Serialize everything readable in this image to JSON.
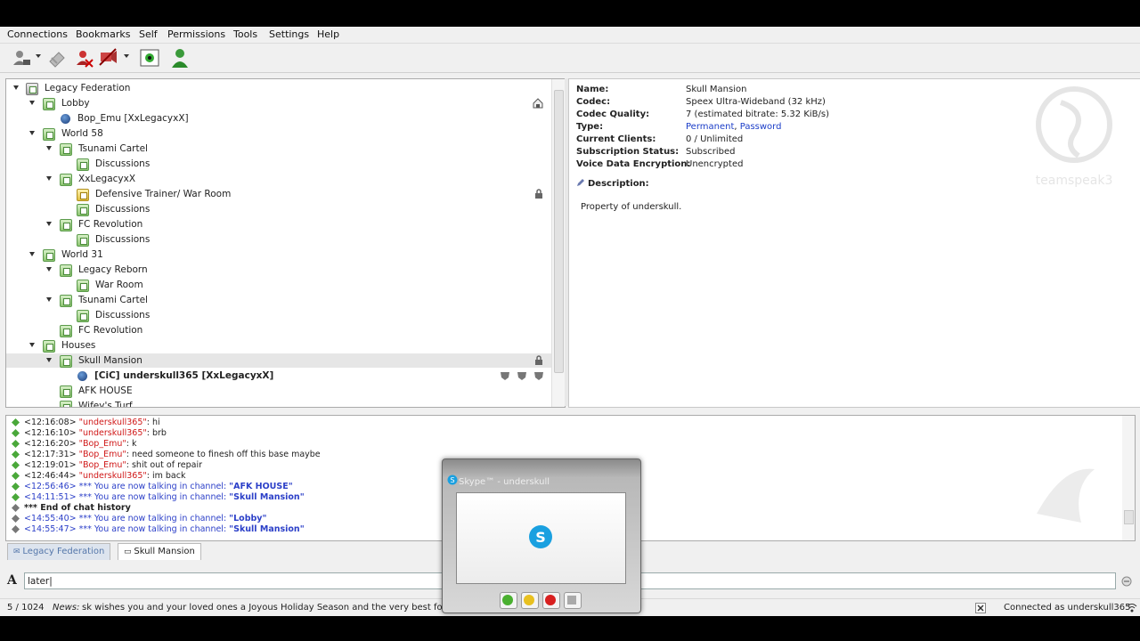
{
  "menu": [
    "Connections",
    "Bookmarks",
    "Self",
    "Permissions",
    "Tools",
    "Settings",
    "Help"
  ],
  "toolbar": {
    "icons": [
      "connect-icon",
      "disconnect-icon",
      "away-icon",
      "mute-microphone-icon",
      "server-view-icon",
      "user-icon"
    ]
  },
  "tree": [
    {
      "label": "Legacy Federation",
      "kind": "server"
    },
    {
      "label": "Lobby",
      "kind": "channel"
    },
    {
      "label": "Bop_Emu [XxLegacyxX]",
      "kind": "user"
    },
    {
      "label": "World 58",
      "kind": "channel"
    },
    {
      "label": "Tsunami Cartel",
      "kind": "channel"
    },
    {
      "label": "Discussions",
      "kind": "channel"
    },
    {
      "label": "XxLegacyxX",
      "kind": "channel"
    },
    {
      "label": "Defensive Trainer/ War Room",
      "kind": "channel"
    },
    {
      "label": "Discussions",
      "kind": "channel"
    },
    {
      "label": "FC Revolution",
      "kind": "channel"
    },
    {
      "label": "Discussions",
      "kind": "channel"
    },
    {
      "label": "World 31",
      "kind": "channel"
    },
    {
      "label": "Legacy Reborn",
      "kind": "channel"
    },
    {
      "label": "War Room",
      "kind": "channel"
    },
    {
      "label": "Tsunami Cartel",
      "kind": "channel"
    },
    {
      "label": "Discussions",
      "kind": "channel"
    },
    {
      "label": "FC Revolution",
      "kind": "channel"
    },
    {
      "label": "Houses",
      "kind": "channel"
    },
    {
      "label": "Skull Mansion",
      "kind": "channel"
    },
    {
      "label": "[CiC] underskull365 [XxLegacyxX]",
      "kind": "user"
    },
    {
      "label": "AFK HOUSE",
      "kind": "channel"
    },
    {
      "label": "Wifey's Turf",
      "kind": "channel"
    }
  ],
  "info": {
    "name_key": "Name:",
    "name": "Skull Mansion",
    "codec_key": "Codec:",
    "codec": "Speex Ultra-Wideband (32 kHz)",
    "quality_key": "Codec Quality:",
    "quality": "7 (estimated bitrate: 5.32 KiB/s)",
    "type_key": "Type:",
    "type_a": "Permanent",
    "type_sep": ", ",
    "type_b": "Password",
    "clients_key": "Current Clients:",
    "clients": "0 / Unlimited",
    "sub_key": "Subscription Status:",
    "sub": "Subscribed",
    "enc_key": "Voice Data Encryption:",
    "enc": "Unencrypted",
    "desc_key": "Description:",
    "desc": "Property of underskull.",
    "logo_text": "teamspeak3"
  },
  "chat": [
    {
      "time": "<12:16:08> ",
      "name": "\"underskull365\"",
      "msg": ": hi",
      "style": "user"
    },
    {
      "time": "<12:16:10> ",
      "name": "\"underskull365\"",
      "msg": ": brb",
      "style": "user"
    },
    {
      "time": "<12:16:20> ",
      "name": "\"Bop_Emu\"",
      "msg": ": k",
      "style": "user"
    },
    {
      "time": "<12:17:31> ",
      "name": "\"Bop_Emu\"",
      "msg": ": need someone to finesh off this base maybe",
      "style": "user"
    },
    {
      "time": "<12:19:01> ",
      "name": "\"Bop_Emu\"",
      "msg": ": shit out of repair",
      "style": "user"
    },
    {
      "time": "<12:46:44> ",
      "name": "\"underskull365\"",
      "msg": ": im back",
      "style": "user"
    },
    {
      "time": "<12:56:46> ",
      "name": "*** You are now talking in channel: ",
      "msg": "\"AFK HOUSE\"",
      "style": "sys"
    },
    {
      "time": "<14:11:51> ",
      "name": "*** You are now talking in channel: ",
      "msg": "\"Skull Mansion\"",
      "style": "sys"
    },
    {
      "time": "",
      "name": "*** End of chat history",
      "msg": "",
      "style": "end"
    },
    {
      "time": "<14:55:40> ",
      "name": "*** You are now talking in channel: ",
      "msg": "\"Lobby\"",
      "style": "sys"
    },
    {
      "time": "<14:55:47> ",
      "name": "*** You are now talking in channel: ",
      "msg": "\"Skull Mansion\"",
      "style": "sys"
    }
  ],
  "tabs": [
    "Legacy Federation",
    "Skull Mansion"
  ],
  "input": {
    "value": "later|"
  },
  "status": {
    "count": "5 / 1024",
    "news_label": "News:",
    "news": "sk wishes you and your loved ones a Joyous Holiday Season and the very best for the New Year",
    "connected": "Connected as underskull365"
  },
  "skype": {
    "title": "Skype™ - underskull"
  }
}
